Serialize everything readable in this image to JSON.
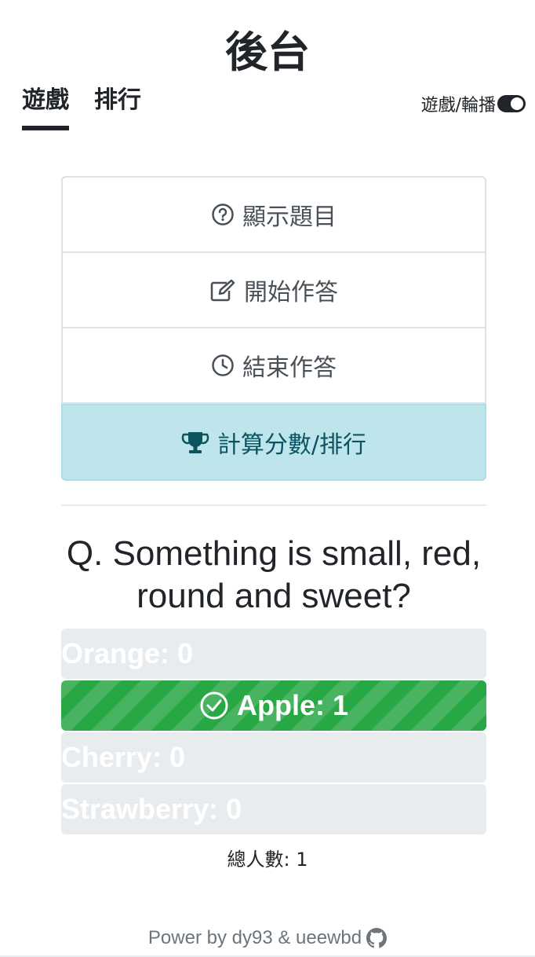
{
  "header": {
    "title": "後台"
  },
  "tabs": [
    {
      "label": "遊戲",
      "active": true
    },
    {
      "label": "排行",
      "active": false
    }
  ],
  "toggle": {
    "label": "遊戲/輪播",
    "on": true
  },
  "actions": {
    "show_question": "顯示題目",
    "start_answer": "開始作答",
    "end_answer": "結束作答",
    "calc_score": "計算分數/排行"
  },
  "question": {
    "text": "Q. Something is small, red, round and sweet?"
  },
  "options": [
    {
      "label": "Orange: 0",
      "correct": false
    },
    {
      "label": "Apple: 1",
      "correct": true
    },
    {
      "label": "Cherry: 0",
      "correct": false
    },
    {
      "label": "Strawberry: 0",
      "correct": false
    }
  ],
  "total": {
    "label": "總人數: 1"
  },
  "footer": {
    "text": "Power by dy93 & ueewbd"
  },
  "colors": {
    "correct": "#28a745",
    "info_bg": "#bee5eb",
    "info_text": "#0c5460",
    "option_bg": "#e9ecef"
  },
  "icons": [
    "question-circle-icon",
    "edit-icon",
    "clock-icon",
    "trophy-icon",
    "check-circle-icon",
    "github-icon"
  ]
}
